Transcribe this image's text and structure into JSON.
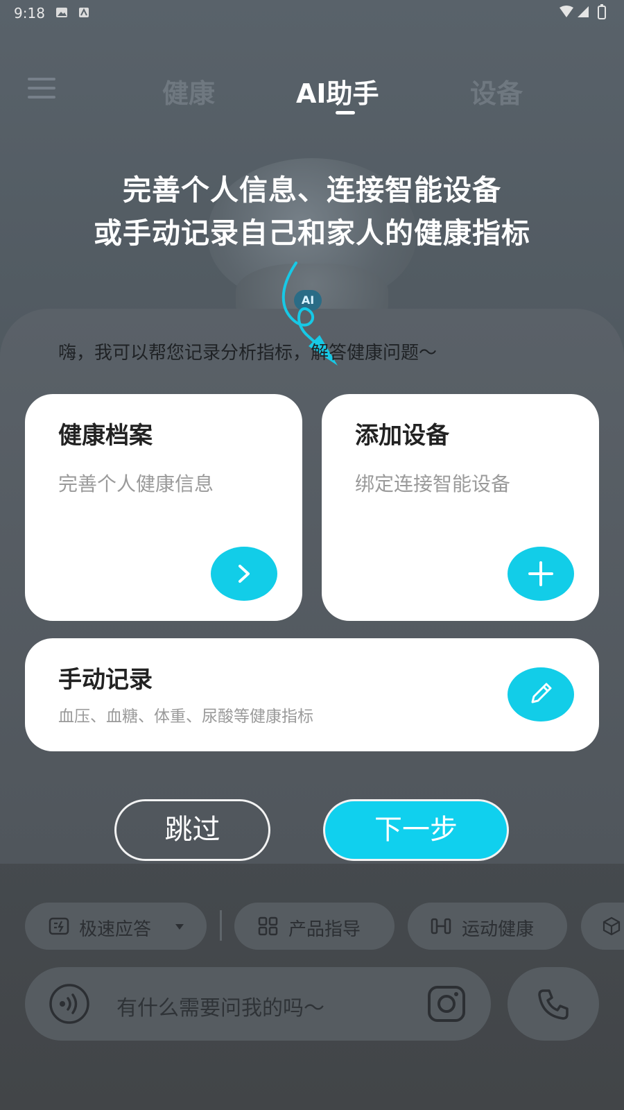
{
  "status_bar": {
    "time": "9:18"
  },
  "nav": {
    "tabs": [
      {
        "label": "健康"
      },
      {
        "label": "AI助手"
      },
      {
        "label": "设备"
      }
    ]
  },
  "mascot": {
    "badge": "AI"
  },
  "guide": {
    "line1": "完善个人信息、连接智能设备",
    "line2": "或手动记录自己和家人的健康指标"
  },
  "greeting": "嗨，我可以帮您记录分析指标，解答健康问题～",
  "cards": {
    "health_profile": {
      "title": "健康档案",
      "subtitle": "完善个人健康信息",
      "icon": "chevron-right-icon"
    },
    "add_device": {
      "title": "添加设备",
      "subtitle": "绑定连接智能设备",
      "icon": "plus-icon"
    },
    "manual_record": {
      "title": "手动记录",
      "subtitle": "血压、血糖、体重、尿酸等健康指标",
      "icon": "pencil-icon"
    }
  },
  "buttons": {
    "skip": "跳过",
    "next": "下一步"
  },
  "chips": [
    {
      "label": "极速应答",
      "icon": "lightning-card-icon"
    },
    {
      "label": "产品指导",
      "icon": "grid-icon"
    },
    {
      "label": "运动健康",
      "icon": "dumbbell-icon"
    }
  ],
  "input": {
    "placeholder": "有什么需要问我的吗～"
  },
  "colors": {
    "accent": "#12cde8",
    "card": "#ffffff",
    "overlay": "#4d555c"
  }
}
